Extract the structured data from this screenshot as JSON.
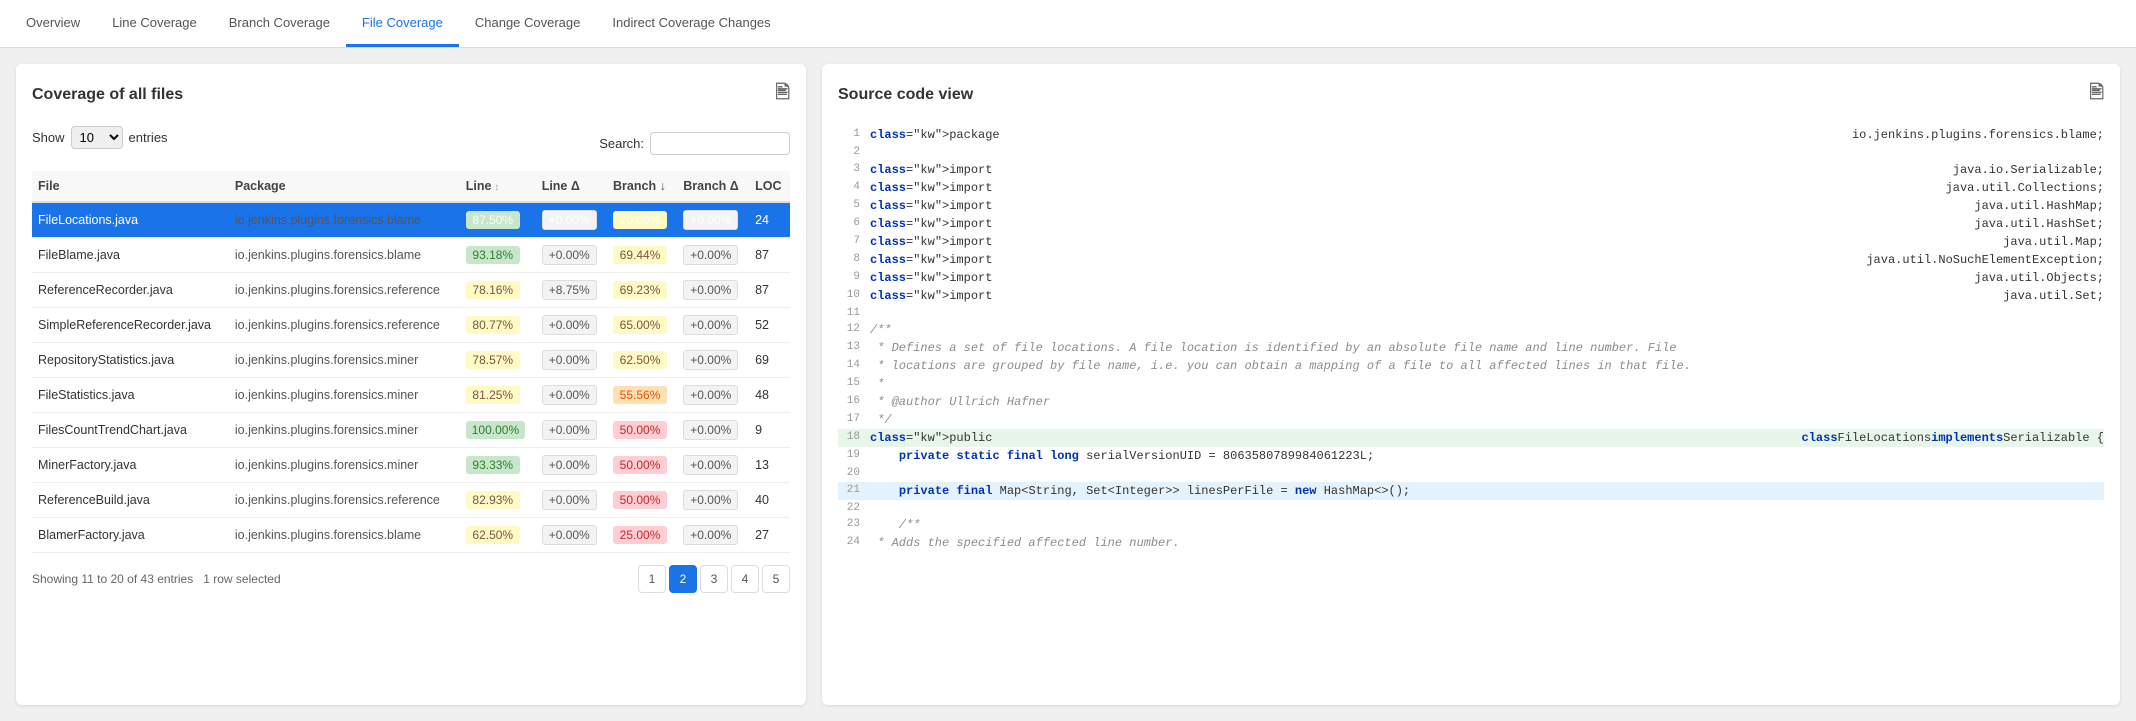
{
  "nav": {
    "tabs": [
      {
        "label": "Overview",
        "active": false
      },
      {
        "label": "Line Coverage",
        "active": false
      },
      {
        "label": "Branch Coverage",
        "active": false
      },
      {
        "label": "File Coverage",
        "active": true
      },
      {
        "label": "Change Coverage",
        "active": false
      },
      {
        "label": "Indirect Coverage Changes",
        "active": false
      }
    ]
  },
  "left_panel": {
    "title": "Coverage of all files",
    "show_label": "Show",
    "entries_label": "entries",
    "entries_value": "10",
    "search_label": "Search:",
    "search_placeholder": "",
    "columns": [
      "File",
      "Package",
      "Line",
      "Line Δ",
      "Branch",
      "Branch Δ",
      "LOC"
    ],
    "rows": [
      {
        "file": "FileLocations.java",
        "package": "io.jenkins.plugins.forensics.blame",
        "line": "87.50%",
        "line_delta": "+0.00%",
        "branch": "70.00%",
        "branch_delta": "+0.00%",
        "loc": "24",
        "selected": true,
        "line_color": "green",
        "branch_color": "yellow"
      },
      {
        "file": "FileBlame.java",
        "package": "io.jenkins.plugins.forensics.blame",
        "line": "93.18%",
        "line_delta": "+0.00%",
        "branch": "69.44%",
        "branch_delta": "+0.00%",
        "loc": "87",
        "selected": false,
        "line_color": "green",
        "branch_color": "yellow"
      },
      {
        "file": "ReferenceRecorder.java",
        "package": "io.jenkins.plugins.forensics.reference",
        "line": "78.16%",
        "line_delta": "+8.75%",
        "branch": "69.23%",
        "branch_delta": "+0.00%",
        "loc": "87",
        "selected": false,
        "line_color": "yellow",
        "branch_color": "yellow"
      },
      {
        "file": "SimpleReferenceRecorder.java",
        "package": "io.jenkins.plugins.forensics.reference",
        "line": "80.77%",
        "line_delta": "+0.00%",
        "branch": "65.00%",
        "branch_delta": "+0.00%",
        "loc": "52",
        "selected": false,
        "line_color": "yellow",
        "branch_color": "yellow"
      },
      {
        "file": "RepositoryStatistics.java",
        "package": "io.jenkins.plugins.forensics.miner",
        "line": "78.57%",
        "line_delta": "+0.00%",
        "branch": "62.50%",
        "branch_delta": "+0.00%",
        "loc": "69",
        "selected": false,
        "line_color": "yellow",
        "branch_color": "yellow"
      },
      {
        "file": "FileStatistics.java",
        "package": "io.jenkins.plugins.forensics.miner",
        "line": "81.25%",
        "line_delta": "+0.00%",
        "branch": "55.56%",
        "branch_delta": "+0.00%",
        "loc": "48",
        "selected": false,
        "line_color": "yellow",
        "branch_color": "orange"
      },
      {
        "file": "FilesCountTrendChart.java",
        "package": "io.jenkins.plugins.forensics.miner",
        "line": "100.00%",
        "line_delta": "+0.00%",
        "branch": "50.00%",
        "branch_delta": "+0.00%",
        "loc": "9",
        "selected": false,
        "line_color": "green",
        "branch_color": "red"
      },
      {
        "file": "MinerFactory.java",
        "package": "io.jenkins.plugins.forensics.miner",
        "line": "93.33%",
        "line_delta": "+0.00%",
        "branch": "50.00%",
        "branch_delta": "+0.00%",
        "loc": "13",
        "selected": false,
        "line_color": "green",
        "branch_color": "red"
      },
      {
        "file": "ReferenceBuild.java",
        "package": "io.jenkins.plugins.forensics.reference",
        "line": "82.93%",
        "line_delta": "+0.00%",
        "branch": "50.00%",
        "branch_delta": "+0.00%",
        "loc": "40",
        "selected": false,
        "line_color": "yellow",
        "branch_color": "red"
      },
      {
        "file": "BlamerFactory.java",
        "package": "io.jenkins.plugins.forensics.blame",
        "line": "62.50%",
        "line_delta": "+0.00%",
        "branch": "25.00%",
        "branch_delta": "+0.00%",
        "loc": "27",
        "selected": false,
        "line_color": "yellow",
        "branch_color": "red"
      }
    ],
    "footer": "Showing 11 to 20 of 43 entries",
    "footer_selected": "1 row selected",
    "pages": [
      "1",
      "2",
      "3",
      "4",
      "5"
    ]
  },
  "right_panel": {
    "title": "Source code view",
    "code_lines": [
      {
        "num": 1,
        "content": "package io.jenkins.plugins.forensics.blame;",
        "highlight": ""
      },
      {
        "num": 2,
        "content": "",
        "highlight": ""
      },
      {
        "num": 3,
        "content": "import java.io.Serializable;",
        "highlight": ""
      },
      {
        "num": 4,
        "content": "import java.util.Collections;",
        "highlight": ""
      },
      {
        "num": 5,
        "content": "import java.util.HashMap;",
        "highlight": ""
      },
      {
        "num": 6,
        "content": "import java.util.HashSet;",
        "highlight": ""
      },
      {
        "num": 7,
        "content": "import java.util.Map;",
        "highlight": ""
      },
      {
        "num": 8,
        "content": "import java.util.NoSuchElementException;",
        "highlight": ""
      },
      {
        "num": 9,
        "content": "import java.util.Objects;",
        "highlight": ""
      },
      {
        "num": 10,
        "content": "import java.util.Set;",
        "highlight": ""
      },
      {
        "num": 11,
        "content": "",
        "highlight": ""
      },
      {
        "num": 12,
        "content": "/**",
        "highlight": ""
      },
      {
        "num": 13,
        "content": " * Defines a set of file locations. A file location is identified by an absolute file name and line number. File",
        "highlight": ""
      },
      {
        "num": 14,
        "content": " * locations are grouped by file name, i.e. you can obtain a mapping of a file to all affected lines in that file.",
        "highlight": ""
      },
      {
        "num": 15,
        "content": " *",
        "highlight": ""
      },
      {
        "num": 16,
        "content": " * @author Ullrich Hafner",
        "highlight": ""
      },
      {
        "num": 17,
        "content": " */",
        "highlight": ""
      },
      {
        "num": 18,
        "content": "public class FileLocations implements Serializable {",
        "highlight": "green"
      },
      {
        "num": 19,
        "content": "    private static final long serialVersionUID = 8063580789984061223L;",
        "highlight": ""
      },
      {
        "num": 20,
        "content": "",
        "highlight": ""
      },
      {
        "num": 21,
        "content": "    private final Map<String, Set<Integer>> linesPerFile = new HashMap<>();",
        "highlight": "blue"
      },
      {
        "num": 22,
        "content": "",
        "highlight": ""
      },
      {
        "num": 23,
        "content": "    /**",
        "highlight": ""
      },
      {
        "num": 24,
        "content": " * Adds the specified affected line number.",
        "highlight": ""
      }
    ]
  }
}
